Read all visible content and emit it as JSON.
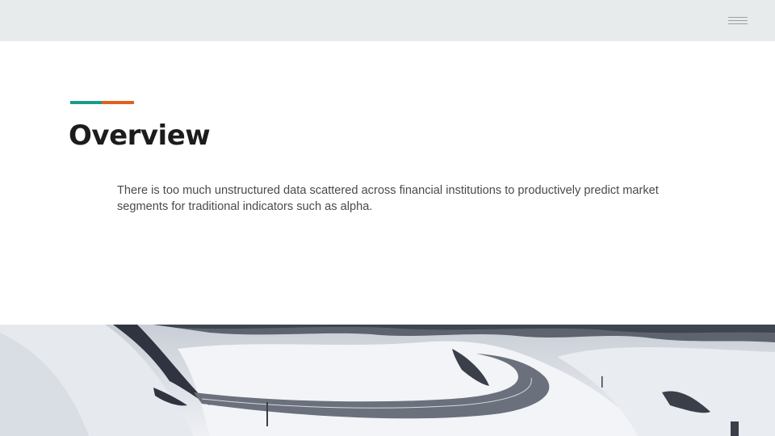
{
  "header": {
    "menu_icon": "hamburger-menu-icon"
  },
  "slide": {
    "accent_colors": {
      "teal": "#1c9a8e",
      "orange": "#e0611f"
    },
    "title": "Overview",
    "body": "There is too much unstructured data scattered across financial institutions to productively predict market segments for traditional indicators such as alpha."
  },
  "image": {
    "description_icon": "snowy-mountain-road-photo"
  }
}
